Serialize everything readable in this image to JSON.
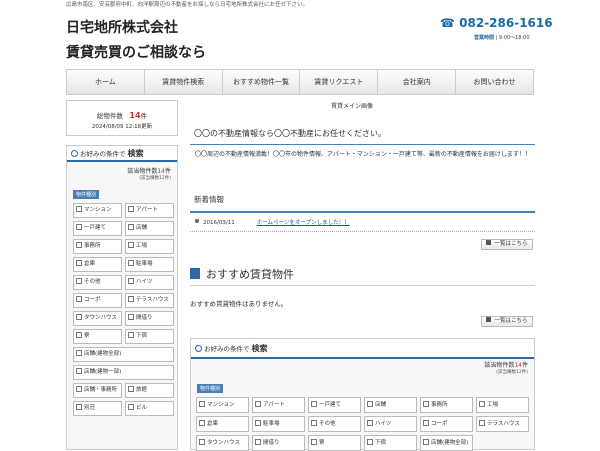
{
  "header": {
    "tagline": "広島市南区、安芸郡府中町、向洋駅周辺の不動産をお探しなら日宅地所株式会社にお任せ下さい。",
    "brand_line1": "日宅地所株式会社",
    "brand_line2": "賃貸売買のご相談なら",
    "tel": "082-286-1616",
    "hours_label": "営業時間",
    "hours": "9:00～18:00"
  },
  "nav": [
    "ホーム",
    "賃貸物件検索",
    "おすすめ物件一覧",
    "賃貸リクエスト",
    "会社案内",
    "お問い合わせ"
  ],
  "counter": {
    "label": "総物件数",
    "count": "14",
    "unit": "件",
    "updated": "2024/08/09 12:18更新"
  },
  "sidebar_search": {
    "title_pre": "お好みの条件で",
    "title": "検索",
    "hit_label": "該当物件数",
    "hit_count": "14",
    "hit_unit": "件",
    "sub": "(該当棟数12件)",
    "type_label": "物件種別",
    "types": [
      "マンション",
      "アパート",
      "一戸建て",
      "店舗",
      "事務所",
      "工場",
      "倉庫",
      "駐車場",
      "その他",
      "ハイツ",
      "コーポ",
      "テラスハウス",
      "タウンハウス",
      "間借り",
      "寮",
      "下宿"
    ],
    "types_wide": [
      "店舗(建物全部)",
      "店舗(建物一部)"
    ],
    "types_tail": [
      "店舗・事務所",
      "旅館",
      "別荘",
      "ビル"
    ]
  },
  "main": {
    "image_alt": "賃貸メイン画像",
    "headline": "〇〇の不動産情報なら〇〇不動産にお任せください。",
    "intro": "〇〇周辺の不動産情報満載！〇〇市の物件情報、アパート・マンション・一戸建て等、最新の不動産情報をお届けします！！",
    "news_title": "新着情報",
    "news": [
      {
        "date": "2016/03/11",
        "text": "ホームページをオープンしました！！"
      }
    ],
    "more": "一覧はこちら",
    "recommend_title": "おすすめ賃貸物件",
    "recommend_empty": "おすすめ賃貸物件はありません。"
  },
  "main_search": {
    "title_pre": "お好みの条件で",
    "title": "検索",
    "hit_label": "該当物件数",
    "hit_count": "14",
    "hit_unit": "件",
    "sub": "(該当棟数12件)",
    "type_label": "物件種別",
    "types": [
      "マンション",
      "アパート",
      "一戸建て",
      "店舗",
      "事務所",
      "工場",
      "倉庫",
      "駐車場",
      "その他",
      "ハイツ",
      "コーポ",
      "テラスハウス",
      "タウンハウス",
      "間借り",
      "寮",
      "下宿",
      "店舗(建物全部)"
    ]
  },
  "colors": {
    "accent": "#2d6aa3",
    "count": "#c0392b",
    "tel": "#1a6aa8"
  }
}
